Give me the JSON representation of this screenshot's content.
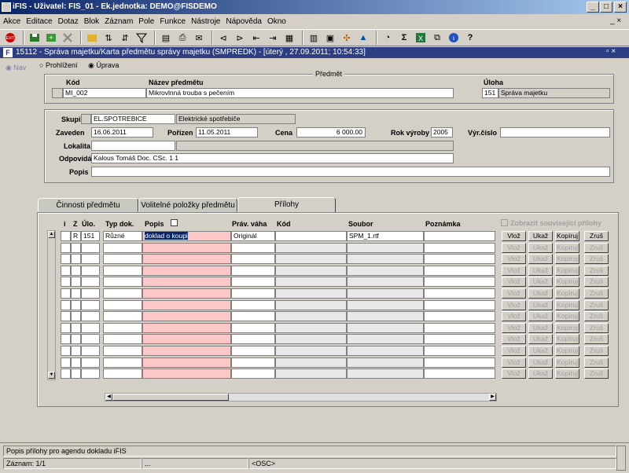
{
  "window_title": "iFIS - Uživatel: FIS_01 - Ek.jednotka: DEMO@FISDEMO",
  "menu": [
    "Akce",
    "Editace",
    "Dotaz",
    "Blok",
    "Záznam",
    "Pole",
    "Funkce",
    "Nástroje",
    "Nápověda",
    "Okno"
  ],
  "toolbar_icons": [
    "exit-icon",
    "save-icon",
    "insert-record-icon",
    "delete-record-icon",
    "query-icon",
    "sort-asc-icon",
    "sort-desc-icon",
    "filter-icon",
    "print-icon",
    "export-icon",
    "mail-icon",
    "prev-record-icon",
    "next-record-icon",
    "first-icon",
    "last-icon",
    "grid-icon",
    "tree-icon",
    "calc-icon",
    "sigma-icon",
    "excel-icon",
    "copy-icon",
    "info-icon",
    "help-icon"
  ],
  "inner_title": "15112 - Správa majetku/Karta předmětu správy majetku (SMPREDK) - [úterý  , 27.09.2011; 10:54:33]",
  "nav_label": "Nav",
  "mode": {
    "browse": "Prohlížení",
    "edit": "Úprava"
  },
  "predmet": {
    "section": "Předmět",
    "kod_label": "Kód",
    "kod": "MI_002",
    "nazev_label": "Název předmětu",
    "nazev": "Mikrovlnná trouba s pečením",
    "uloha_label": "Úloha",
    "uloha_code": "151",
    "uloha_name": "Správa majetku"
  },
  "detail": {
    "skupina_label": "Skupina",
    "skupina_code": "EL.SPOTREBICE",
    "skupina_name": "Elektrické spotřebiče",
    "zaveden_label": "Zaveden",
    "zaveden": "16.06.2011",
    "porizen_label": "Pořízen",
    "porizen": "11.05.2011",
    "cena_label": "Cena",
    "cena": "6 000.00",
    "rok_label": "Rok výroby",
    "rok": "2005",
    "vyr_label": "Výr.číslo",
    "vyr": "",
    "lokalita_label": "Lokalita",
    "lokalita": "",
    "odpovida_label": "Odpovídá",
    "odpovida": "Kalous Tomáš Doc. CSc. 1 1",
    "popis_label": "Popis",
    "popis": ""
  },
  "tabs": [
    "Činnosti předmětu",
    "Volitelné položky předmětu",
    "Přílohy"
  ],
  "grid": {
    "headers": {
      "i": "i",
      "z": "Z",
      "ulo": "Úlo.",
      "typ": "Typ dok.",
      "popis": "Popis",
      "prav": "Práv. váha",
      "kod": "Kód",
      "soubor": "Soubor",
      "poznamka": "Poznámka"
    },
    "show_related": "Zobrazit související přílohy",
    "row1": {
      "z": "R",
      "ulo": "151",
      "typ": "Různé",
      "popis": "doklad o koupi",
      "prav": "Originál",
      "kod": "",
      "soubor": "SPM_1.rtf",
      "poznamka": ""
    },
    "buttons": {
      "vloz": "Vlož",
      "ukaz": "Ukaž",
      "kopiruj": "Kopíruj",
      "zrus": "Zruš"
    }
  },
  "status": {
    "hint": "Popis přílohy pro agendu dokladu iFIS",
    "record": "Záznam: 1/1",
    "dots": "...",
    "osc": "<OSC>"
  }
}
